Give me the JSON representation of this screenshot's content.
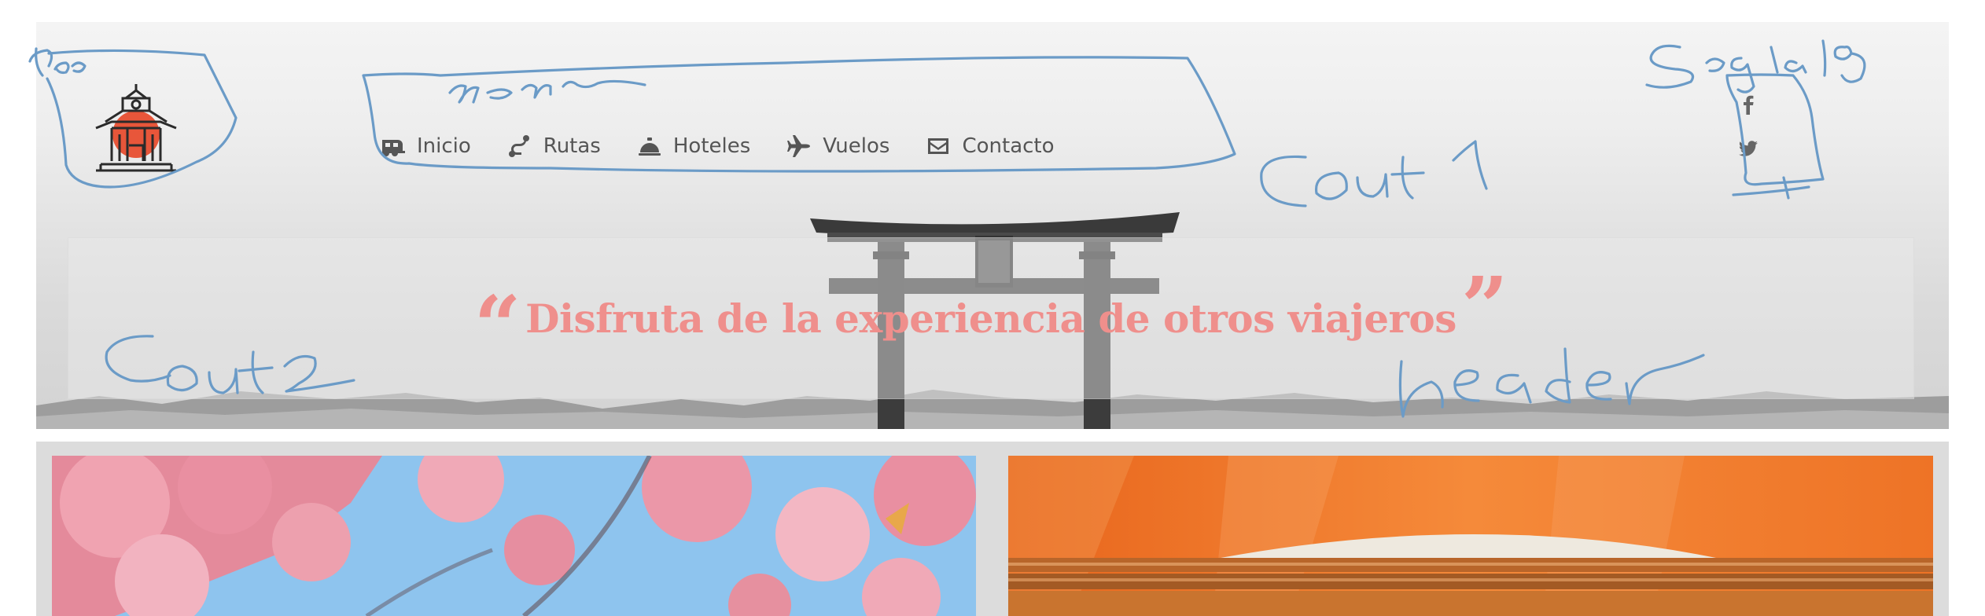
{
  "header": {
    "logo_icon": "pagoda-logo-icon",
    "nav": [
      {
        "icon": "caravan-icon",
        "label": "Inicio"
      },
      {
        "icon": "route-icon",
        "label": "Rutas"
      },
      {
        "icon": "bell-icon",
        "label": "Hoteles"
      },
      {
        "icon": "plane-icon",
        "label": "Vuelos"
      },
      {
        "icon": "envelope-icon",
        "label": "Contacto"
      }
    ],
    "social": [
      {
        "icon": "facebook-icon"
      },
      {
        "icon": "twitter-icon"
      }
    ],
    "quote": "Disfruta de la experiencia de otros viajeros",
    "quote_open": "“",
    "quote_close": "”"
  },
  "colors": {
    "quote": "#ef8f8c",
    "nav_text": "#555555",
    "sketch_ink": "#6b9bc7",
    "logo_sun": "#e8563a"
  },
  "annotations": {
    "logo": "logo",
    "menu": "menu",
    "social": "Social",
    "cont1": "Cont 1",
    "cont2": "Cont2",
    "header": "header"
  },
  "gallery": [
    {
      "icon": "cherry-blossom-photo"
    },
    {
      "icon": "chopsticks-bowl-photo"
    }
  ]
}
